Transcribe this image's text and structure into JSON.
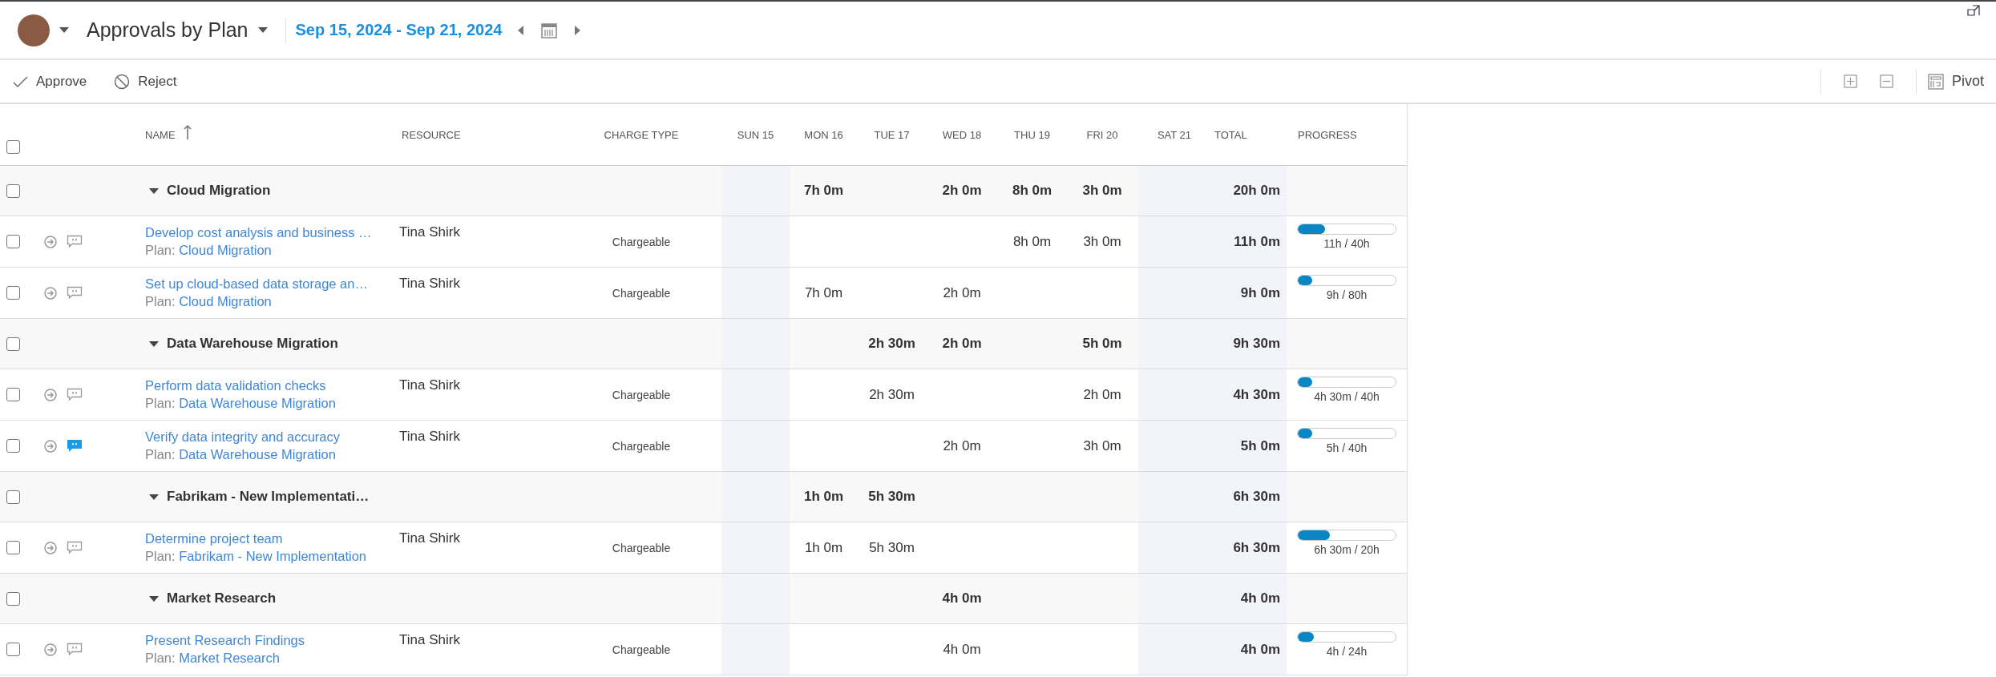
{
  "header": {
    "title": "Approvals by Plan",
    "date_range": "Sep 15, 2024 - Sep 21, 2024"
  },
  "toolbar": {
    "actions": [
      {
        "kind": "approve",
        "label": "Approve"
      },
      {
        "kind": "reject",
        "label": "Reject"
      }
    ],
    "pivot_label": "Pivot"
  },
  "table": {
    "all_checked": false,
    "columns": [
      {
        "label": "NAME",
        "sorted_ascending": true
      },
      {
        "label": "RESOURCE"
      },
      {
        "label": "CHARGE TYPE"
      },
      {
        "label": "SUN 15"
      },
      {
        "label": "MON 16"
      },
      {
        "label": "TUE 17"
      },
      {
        "label": "WED 18"
      },
      {
        "label": "THU 19"
      },
      {
        "label": "FRI 20"
      },
      {
        "label": "SAT 21"
      },
      {
        "label": "TOTAL"
      },
      {
        "label": "PROGRESS"
      }
    ],
    "groups": [
      {
        "name": "Cloud Migration",
        "expanded": true,
        "checked": false,
        "days": {
          "mon": "7h 0m",
          "wed": "2h 0m",
          "thu": "8h 0m",
          "fri": "3h 0m"
        },
        "total": "20h 0m",
        "tasks": [
          {
            "name": "Develop cost analysis and business …",
            "plan_prefix": "Plan:",
            "plan": "Cloud Migration",
            "resource": "Tina Shirk",
            "charge_type": "Chargeable",
            "days": {
              "thu": "8h 0m",
              "fri": "3h 0m"
            },
            "total": "11h 0m",
            "progress": {
              "level": 0.275,
              "reading": "11h / 40h"
            },
            "has_comment": false,
            "checked": false
          },
          {
            "name": "Set up cloud-based data storage an…",
            "plan_prefix": "Plan:",
            "plan": "Cloud Migration",
            "resource": "Tina Shirk",
            "charge_type": "Chargeable",
            "days": {
              "mon": "7h 0m",
              "wed": "2h 0m"
            },
            "total": "9h 0m",
            "progress": {
              "level": 0.1125,
              "reading": "9h / 80h"
            },
            "has_comment": false,
            "checked": false
          }
        ]
      },
      {
        "name": "Data Warehouse Migration",
        "expanded": true,
        "checked": false,
        "days": {
          "tue": "2h 30m",
          "wed": "2h 0m",
          "fri": "5h 0m"
        },
        "total": "9h 30m",
        "tasks": [
          {
            "name": "Perform data validation checks",
            "plan_prefix": "Plan:",
            "plan": "Data Warehouse Migration",
            "resource": "Tina Shirk",
            "charge_type": "Chargeable",
            "days": {
              "tue": "2h 30m",
              "fri": "2h 0m"
            },
            "total": "4h 30m",
            "progress": {
              "level": 0.1125,
              "reading": "4h 30m / 40h"
            },
            "has_comment": false,
            "checked": false
          },
          {
            "name": "Verify data integrity and accuracy",
            "plan_prefix": "Plan:",
            "plan": "Data Warehouse Migration",
            "resource": "Tina Shirk",
            "charge_type": "Chargeable",
            "days": {
              "wed": "2h 0m",
              "fri": "3h 0m"
            },
            "total": "5h 0m",
            "progress": {
              "level": 0.125,
              "reading": "5h / 40h"
            },
            "has_comment": true,
            "checked": false
          }
        ]
      },
      {
        "name": "Fabrikam - New Implementati…",
        "expanded": true,
        "checked": false,
        "days": {
          "mon": "1h 0m",
          "tue": "5h 30m"
        },
        "total": "6h 30m",
        "tasks": [
          {
            "name": "Determine project team",
            "plan_prefix": "Plan:",
            "plan": "Fabrikam - New Implementation",
            "resource": "Tina Shirk",
            "charge_type": "Chargeable",
            "days": {
              "mon": "1h 0m",
              "tue": "5h 30m"
            },
            "total": "6h 30m",
            "progress": {
              "level": 0.325,
              "reading": "6h 30m / 20h"
            },
            "has_comment": false,
            "checked": false
          }
        ]
      },
      {
        "name": "Market Research",
        "expanded": true,
        "checked": false,
        "days": {
          "wed": "4h 0m"
        },
        "total": "4h 0m",
        "tasks": [
          {
            "name": "Present Research Findings",
            "plan_prefix": "Plan:",
            "plan": "Market Research",
            "resource": "Tina Shirk",
            "charge_type": "Chargeable",
            "days": {
              "wed": "4h 0m"
            },
            "total": "4h 0m",
            "progress": {
              "level": 0.167,
              "reading": "4h / 24h"
            },
            "has_comment": false,
            "checked": false
          }
        ]
      }
    ]
  }
}
